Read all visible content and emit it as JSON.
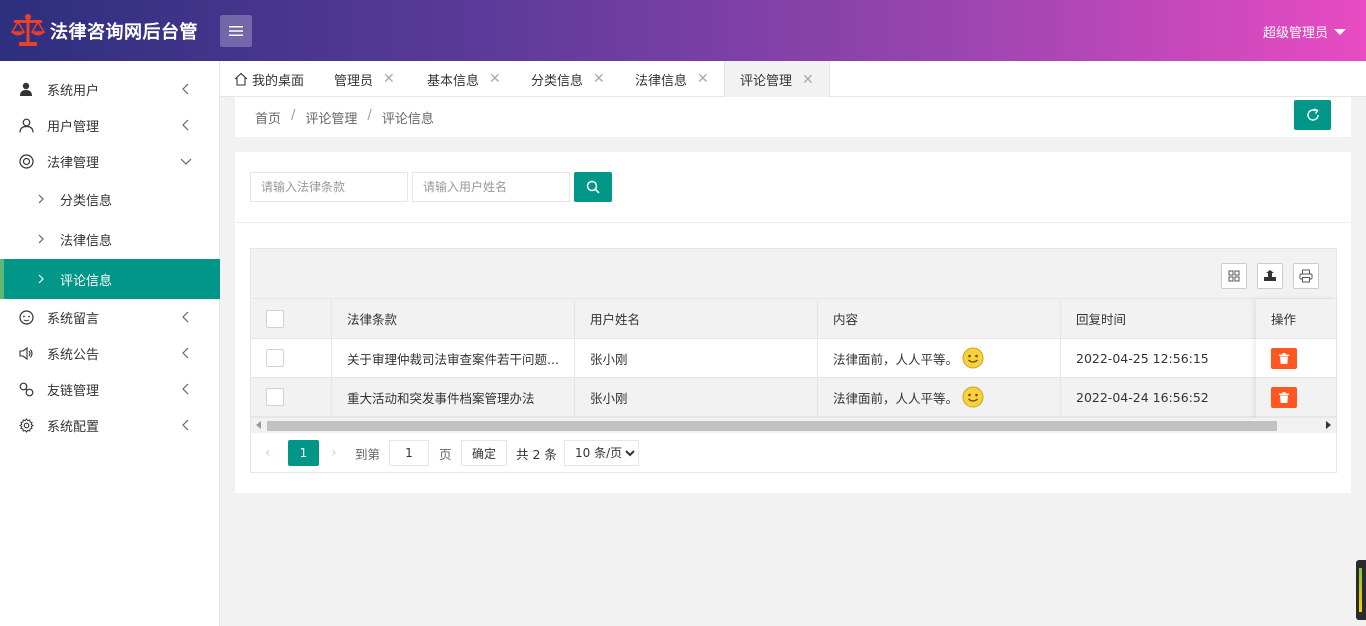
{
  "header": {
    "app_title": "法律咨询网后台管",
    "user_name": "超级管理员"
  },
  "sidebar": {
    "items": [
      {
        "label": "系统用户",
        "icon": "user-solid-icon"
      },
      {
        "label": "用户管理",
        "icon": "user-outline-icon"
      },
      {
        "label": "法律管理",
        "icon": "circle-icon",
        "expanded": true
      },
      {
        "label": "系统留言",
        "icon": "face-icon"
      },
      {
        "label": "系统公告",
        "icon": "speaker-icon"
      },
      {
        "label": "友链管理",
        "icon": "link-icon"
      },
      {
        "label": "系统配置",
        "icon": "gear-icon"
      }
    ],
    "sub_items": [
      {
        "label": "分类信息"
      },
      {
        "label": "法律信息"
      },
      {
        "label": "评论信息",
        "active": true
      }
    ]
  },
  "tabs": [
    {
      "label": "我的桌面",
      "closable": false
    },
    {
      "label": "管理员",
      "closable": true
    },
    {
      "label": "基本信息",
      "closable": true
    },
    {
      "label": "分类信息",
      "closable": true
    },
    {
      "label": "法律信息",
      "closable": true
    },
    {
      "label": "评论管理",
      "closable": true,
      "active": true
    }
  ],
  "breadcrumb": [
    "首页",
    "评论管理",
    "评论信息"
  ],
  "search": {
    "law_placeholder": "请输入法律条款",
    "user_placeholder": "请输入用户姓名"
  },
  "table": {
    "headers": [
      "法律条款",
      "用户姓名",
      "内容",
      "回复时间",
      "操作"
    ],
    "rows": [
      {
        "law": "关于审理仲裁司法审查案件若干问题...",
        "user": "张小刚",
        "content": "法律面前，人人平等。",
        "time": "2022-04-25 12:56:15"
      },
      {
        "law": "重大活动和突发事件档案管理办法",
        "user": "张小刚",
        "content": "法律面前，人人平等。",
        "time": "2022-04-24 16:56:52"
      }
    ]
  },
  "pager": {
    "current": "1",
    "goto_label": "到第",
    "goto_value": "1",
    "page_label": "页",
    "confirm_label": "确定",
    "total_label": "共 2 条",
    "page_size": "10 条/页"
  },
  "colors": {
    "primary": "#009688",
    "danger": "#ff5722",
    "header_start": "#2d2f7d",
    "header_end": "#e94bc2"
  }
}
